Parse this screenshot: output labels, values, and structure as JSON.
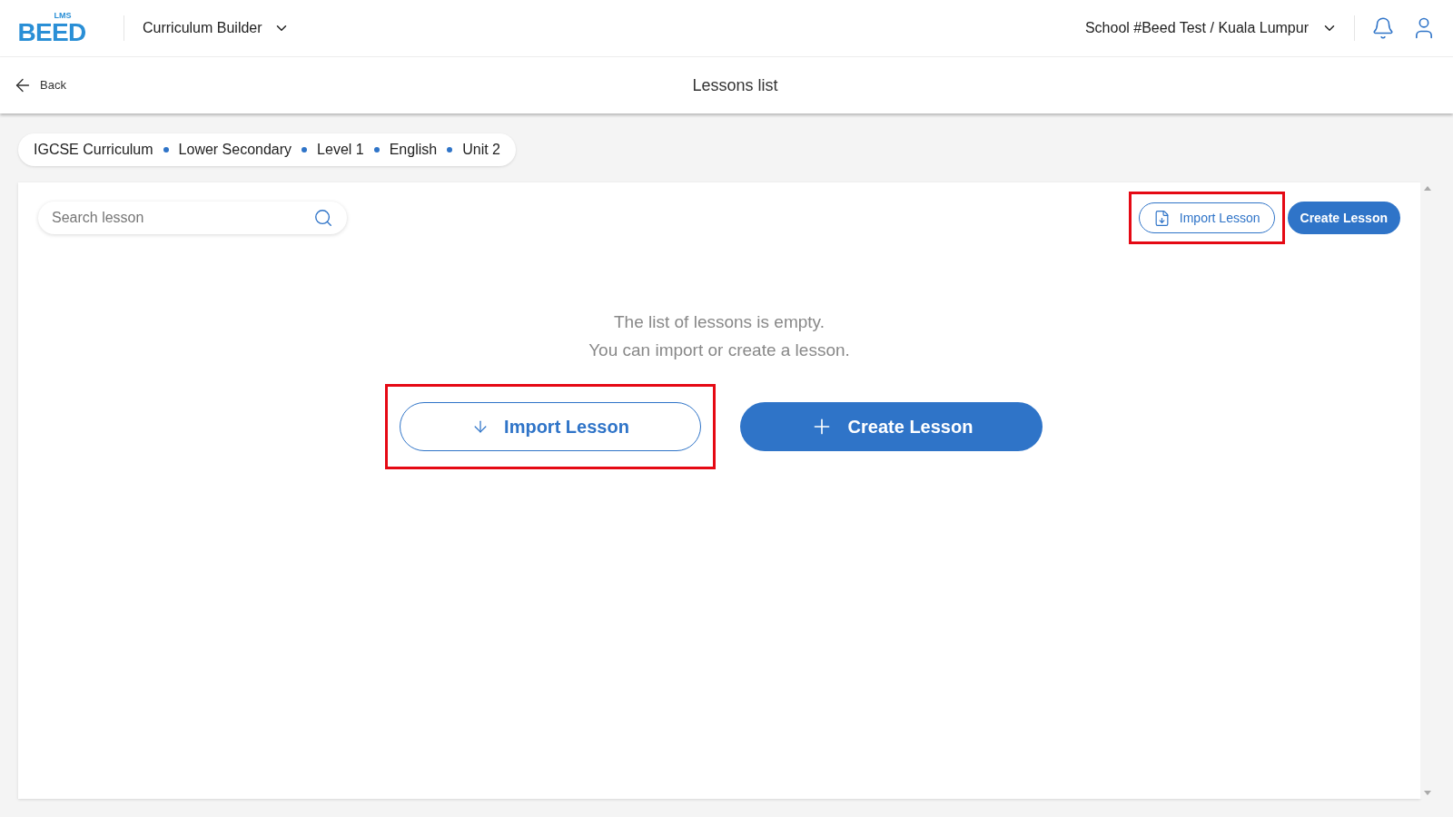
{
  "header": {
    "logo": {
      "wordmark": "BEED",
      "tag": "LMS"
    },
    "app_menu": "Curriculum Builder",
    "school_menu": "School #Beed Test / Kuala Lumpur"
  },
  "subheader": {
    "back": "Back",
    "title": "Lessons list"
  },
  "breadcrumb": [
    "IGCSE Curriculum",
    "Lower Secondary",
    "Level 1",
    "English",
    "Unit 2"
  ],
  "search": {
    "placeholder": "Search lesson"
  },
  "toolbar": {
    "import": {
      "label": "Import Lesson",
      "highlighted": true
    },
    "create": {
      "label": "Create Lesson",
      "highlighted": false
    }
  },
  "empty_state": {
    "lines": [
      "The list of lessons is empty.",
      "You can import or create a lesson."
    ],
    "import": {
      "label": "Import Lesson",
      "highlighted": true
    },
    "create": {
      "label": "Create Lesson",
      "highlighted": false
    }
  }
}
